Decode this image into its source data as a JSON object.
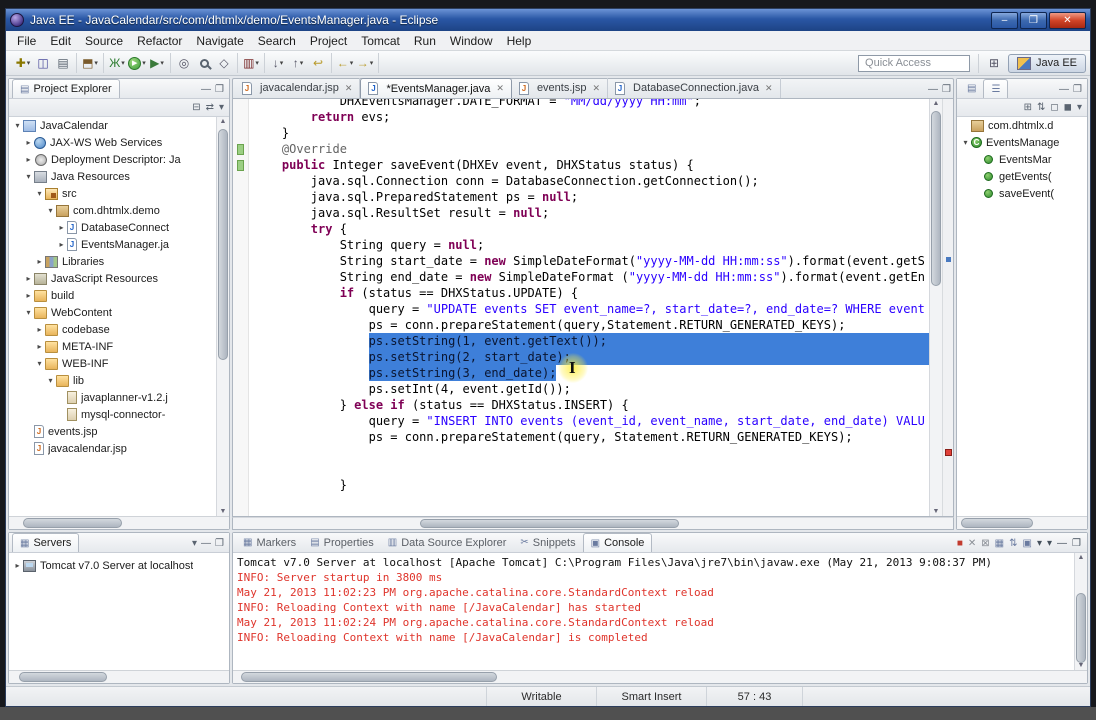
{
  "colors": {
    "selection": "#3e7fd9",
    "keyword": "#7f0055",
    "string": "#2a00ff",
    "annotation": "#646464",
    "stderr": "#df342b",
    "titlebar": "#2a57a5"
  },
  "window": {
    "title": "Java EE - JavaCalendar/src/com/dhtmlx/demo/EventsManager.java - Eclipse",
    "controls": [
      {
        "n": "minimize-button",
        "g": "–"
      },
      {
        "n": "maximize-button",
        "g": "❐"
      },
      {
        "n": "close-button",
        "g": "✕",
        "cls": "close"
      }
    ]
  },
  "menu": {
    "items": [
      "File",
      "Edit",
      "Source",
      "Refactor",
      "Navigate",
      "Search",
      "Project",
      "Tomcat",
      "Run",
      "Window",
      "Help"
    ]
  },
  "toolbar": {
    "quick_access": "Quick Access",
    "perspective": {
      "label": "Java EE"
    },
    "open_perspective_glyph": "⊞",
    "groups": [
      [
        {
          "n": "new-wizard-button",
          "g": "✚",
          "c": "#8a7800",
          "dd": true
        },
        {
          "n": "save-button",
          "g": "◫",
          "c": "#4a4a9c"
        },
        {
          "n": "print-button",
          "g": "▤",
          "c": "#5a6470"
        }
      ],
      [
        {
          "n": "new-java-ee-project-button",
          "g": "⬒",
          "c": "#7a5a2a",
          "dd": true
        }
      ],
      [
        {
          "n": "debug-button",
          "g": "Ж",
          "c": "#2f7d32",
          "dd": true
        },
        {
          "n": "run-button",
          "cls": "run-ic",
          "g": "▶",
          "dd": true
        },
        {
          "n": "external-tools-button",
          "g": "▶",
          "c": "#3a7a3a",
          "dd": true
        }
      ],
      [
        {
          "n": "new-servlet-button",
          "g": "◎",
          "c": "#556",
          "dd": false
        },
        {
          "n": "search-button",
          "cls": "mag",
          "g": ""
        },
        {
          "n": "open-type-button",
          "g": "◇",
          "c": "#556"
        }
      ],
      [
        {
          "n": "coverage-button",
          "g": "▥",
          "c": "#7a2a2a",
          "dd": true
        }
      ],
      [
        {
          "n": "next-annotation-button",
          "g": "↓",
          "c": "#556",
          "dd": true
        },
        {
          "n": "previous-annotation-button",
          "g": "↑",
          "c": "#556",
          "dd": true
        },
        {
          "n": "last-edit-location-button",
          "g": "↩",
          "c": "#b89a2a"
        }
      ],
      [
        {
          "n": "back-button",
          "g": "←",
          "c": "#b89a2a",
          "dd": true
        },
        {
          "n": "forward-button",
          "g": "→",
          "c": "#b89a2a",
          "dd": true
        }
      ]
    ]
  },
  "minmax": [
    {
      "n": "minimize-button",
      "g": "—"
    },
    {
      "n": "maximize-button",
      "g": "❐"
    }
  ],
  "icon_defs": {
    "jfile": {
      "letter": "J",
      "color": "#1f62c9"
    },
    "jsp": {
      "letter": "J",
      "color": "#cf6a1f"
    },
    "class": {
      "letter": "C",
      "color": "#ffffff"
    }
  },
  "project_explorer": {
    "tab": "Project Explorer",
    "tools": [
      {
        "n": "collapse-all-icon",
        "g": "⊟"
      },
      {
        "n": "link-with-editor-icon",
        "g": "⇄"
      },
      {
        "n": "view-menu-icon",
        "g": "▾"
      }
    ],
    "items": [
      {
        "d": 0,
        "arrow": "down",
        "icon": "project",
        "label": "JavaCalendar"
      },
      {
        "d": 1,
        "arrow": "right",
        "icon": "jaxws",
        "label": "JAX-WS Web Services"
      },
      {
        "d": 1,
        "arrow": "right",
        "icon": "dd",
        "label": "Deployment Descriptor: Ja"
      },
      {
        "d": 1,
        "arrow": "down",
        "icon": "jres",
        "label": "Java Resources"
      },
      {
        "d": 2,
        "arrow": "down",
        "icon": "srcpkg",
        "label": "src"
      },
      {
        "d": 3,
        "arrow": "down",
        "icon": "package",
        "label": "com.dhtmlx.demo"
      },
      {
        "d": 4,
        "arrow": "right",
        "icon": "jfile",
        "label": "DatabaseConnect"
      },
      {
        "d": 4,
        "arrow": "right",
        "icon": "jfile",
        "label": "EventsManager.ja"
      },
      {
        "d": 2,
        "arrow": "right",
        "icon": "libs",
        "label": "Libraries"
      },
      {
        "d": 1,
        "arrow": "right",
        "icon": "jsres",
        "label": "JavaScript Resources"
      },
      {
        "d": 1,
        "arrow": "right",
        "icon": "folder",
        "label": "build"
      },
      {
        "d": 1,
        "arrow": "down",
        "icon": "folder",
        "label": "WebContent"
      },
      {
        "d": 2,
        "arrow": "right",
        "icon": "folder",
        "label": "codebase"
      },
      {
        "d": 2,
        "arrow": "right",
        "icon": "folder",
        "label": "META-INF"
      },
      {
        "d": 2,
        "arrow": "down",
        "icon": "folder",
        "label": "WEB-INF"
      },
      {
        "d": 3,
        "arrow": "down",
        "icon": "folder",
        "label": "lib"
      },
      {
        "d": 4,
        "arrow": "none",
        "icon": "jar",
        "label": "javaplanner-v1.2.j"
      },
      {
        "d": 4,
        "arrow": "none",
        "icon": "jar",
        "label": "mysql-connector-"
      },
      {
        "d": 1,
        "arrow": "none",
        "icon": "jsp",
        "label": "events.jsp"
      },
      {
        "d": 1,
        "arrow": "none",
        "icon": "jsp",
        "label": "javacalendar.jsp"
      }
    ]
  },
  "editor": {
    "tabs": [
      {
        "label": "javacalendar.jsp",
        "icon": "jsp",
        "active": false
      },
      {
        "label": "*EventsManager.java",
        "icon": "jfile",
        "active": true
      },
      {
        "label": "events.jsp",
        "icon": "jsp",
        "active": false
      },
      {
        "label": "DatabaseConnection.java",
        "icon": "jfile",
        "active": false
      }
    ],
    "cursor": {
      "glyph": "I"
    },
    "code": {
      "marks": [
        3,
        4
      ],
      "lines": [
        {
          "segs": [
            [
              "p",
              "            DHXEventsManager.DATE_FORMAT = "
            ],
            [
              "s",
              "\"MM/dd/yyyy HH:mm\""
            ],
            [
              "p",
              ";"
            ]
          ]
        },
        {
          "segs": [
            [
              "p",
              "        "
            ],
            [
              "k",
              "return"
            ],
            [
              "p",
              " evs;"
            ]
          ]
        },
        {
          "segs": [
            [
              "p",
              "    }"
            ]
          ]
        },
        {
          "segs": [
            [
              "a",
              "    @Override"
            ]
          ]
        },
        {
          "segs": [
            [
              "p",
              "    "
            ],
            [
              "k",
              "public"
            ],
            [
              "p",
              " Integer saveEvent(DHXEv event, DHXStatus status) {"
            ]
          ]
        },
        {
          "segs": [
            [
              "p",
              "        java.sql.Connection conn = DatabaseConnection.getConnection();"
            ]
          ]
        },
        {
          "segs": [
            [
              "p",
              "        java.sql.PreparedStatement ps = "
            ],
            [
              "k",
              "null"
            ],
            [
              "p",
              ";"
            ]
          ]
        },
        {
          "segs": [
            [
              "p",
              "        java.sql.ResultSet result = "
            ],
            [
              "k",
              "null"
            ],
            [
              "p",
              ";"
            ]
          ]
        },
        {
          "segs": [
            [
              "p",
              "        "
            ],
            [
              "k",
              "try"
            ],
            [
              "p",
              " {"
            ]
          ]
        },
        {
          "segs": [
            [
              "p",
              "            String query = "
            ],
            [
              "k",
              "null"
            ],
            [
              "p",
              ";"
            ]
          ]
        },
        {
          "segs": [
            [
              "p",
              "            String start_date = "
            ],
            [
              "k",
              "new"
            ],
            [
              "p",
              " SimpleDateFormat("
            ],
            [
              "s",
              "\"yyyy-MM-dd HH:mm:ss\""
            ],
            [
              "p",
              ").format(event.getS"
            ]
          ]
        },
        {
          "segs": [
            [
              "p",
              "            String end_date = "
            ],
            [
              "k",
              "new"
            ],
            [
              "p",
              " SimpleDateFormat ("
            ],
            [
              "s",
              "\"yyyy-MM-dd HH:mm:ss\""
            ],
            [
              "p",
              ").format(event.getEn"
            ]
          ]
        },
        {
          "segs": [
            [
              "p",
              "            "
            ],
            [
              "k",
              "if"
            ],
            [
              "p",
              " (status == DHXStatus.UPDATE) {"
            ]
          ]
        },
        {
          "segs": [
            [
              "p",
              "                query = "
            ],
            [
              "s",
              "\"UPDATE events SET event_name=?, start_date=?, end_date=? WHERE event"
            ]
          ]
        },
        {
          "segs": [
            [
              "p",
              "                ps = conn.prepareStatement(query,Statement.RETURN_GENERATED_KEYS);"
            ]
          ]
        },
        {
          "segs": [
            [
              "p",
              "                "
            ],
            [
              "ps",
              "ps.setString(1, event.getText());"
            ],
            [
              "fill",
              ""
            ]
          ]
        },
        {
          "segs": [
            [
              "p",
              "                "
            ],
            [
              "ps",
              "ps.setString(2, start_date);"
            ],
            [
              "fill",
              ""
            ]
          ]
        },
        {
          "segs": [
            [
              "p",
              "                "
            ],
            [
              "ps",
              "ps.setString(3, end_date);"
            ]
          ]
        },
        {
          "segs": [
            [
              "p",
              "                ps.setInt(4, event.getId());"
            ]
          ]
        },
        {
          "segs": [
            [
              "p",
              "            } "
            ],
            [
              "k",
              "else"
            ],
            [
              "p",
              " "
            ],
            [
              "k",
              "if"
            ],
            [
              "p",
              " (status == DHXStatus.INSERT) {"
            ]
          ]
        },
        {
          "segs": [
            [
              "p",
              "                query = "
            ],
            [
              "s",
              "\"INSERT INTO events (event_id, event_name, start_date, end_date) VALU"
            ]
          ]
        },
        {
          "segs": [
            [
              "p",
              "                ps = conn.prepareStatement(query, Statement.RETURN_GENERATED_KEYS);"
            ]
          ]
        },
        {
          "segs": [
            [
              "p",
              ""
            ]
          ]
        },
        {
          "segs": [
            [
              "p",
              ""
            ]
          ]
        },
        {
          "segs": [
            [
              "p",
              "            }"
            ]
          ]
        },
        {
          "segs": [
            [
              "p",
              ""
            ]
          ]
        }
      ]
    }
  },
  "outline": {
    "tabs": [
      {
        "n": "task-list-tab",
        "g": "▤"
      },
      {
        "n": "outline-tab",
        "g": "☰"
      }
    ],
    "tools": [
      {
        "n": "expand-all-icon",
        "g": "⊞"
      },
      {
        "n": "sort-icon",
        "g": "⇅"
      },
      {
        "n": "hide-fields-icon",
        "g": "◻"
      },
      {
        "n": "hide-static-icon",
        "g": "◼"
      },
      {
        "n": "view-menu-icon",
        "g": "▾"
      }
    ],
    "items": [
      {
        "d": 0,
        "arrow": "none",
        "icon": "package",
        "label": "com.dhtmlx.d"
      },
      {
        "d": 0,
        "arrow": "down",
        "icon": "class",
        "label": "EventsManage"
      },
      {
        "d": 1,
        "arrow": "none",
        "icon": "ctor",
        "label": "EventsMar"
      },
      {
        "d": 1,
        "arrow": "none",
        "icon": "method",
        "label": "getEvents("
      },
      {
        "d": 1,
        "arrow": "none",
        "icon": "method",
        "label": "saveEvent("
      }
    ]
  },
  "servers": {
    "tab": "Servers",
    "tools": [
      {
        "n": "view-menu-icon",
        "g": "▾"
      }
    ],
    "items": [
      {
        "d": 0,
        "arrow": "right",
        "icon": "server",
        "label": "Tomcat v7.0 Server at localhost"
      }
    ]
  },
  "console_area": {
    "tabs": [
      {
        "label": "Markers",
        "icon": "▦",
        "icon_name": "markers-icon",
        "active": false
      },
      {
        "label": "Properties",
        "icon": "▤",
        "icon_name": "properties-icon",
        "active": false
      },
      {
        "label": "Data Source Explorer",
        "icon": "▥",
        "icon_name": "data-source-explorer-icon",
        "active": false
      },
      {
        "label": "Snippets",
        "icon": "✂",
        "icon_name": "snippets-icon",
        "active": false
      },
      {
        "label": "Console",
        "icon": "▣",
        "icon_name": "console-icon",
        "active": true
      }
    ],
    "tools": [
      {
        "n": "terminate-icon",
        "g": "■",
        "c": "#c23b2e"
      },
      {
        "n": "remove-launch-icon",
        "g": "✕",
        "c": "#8a8f96"
      },
      {
        "n": "remove-all-launches-icon",
        "g": "⊠",
        "c": "#8a8f96"
      },
      {
        "n": "clear-console-icon",
        "g": "▦",
        "c": "#6a7ba0"
      },
      {
        "n": "scroll-lock-icon",
        "g": "⇅",
        "c": "#6a7ba0"
      },
      {
        "n": "pin-console-icon",
        "g": "▣",
        "c": "#6a7ba0"
      },
      {
        "n": "display-console-icon",
        "g": "▾",
        "c": "#44505c"
      },
      {
        "n": "open-console-icon",
        "g": "▾",
        "c": "#44505c"
      },
      {
        "n": "minimize-icon",
        "g": "—",
        "c": "#44505c"
      },
      {
        "n": "maximize-icon",
        "g": "❐",
        "c": "#44505c"
      }
    ],
    "lines": [
      {
        "t": "Tomcat v7.0 Server at localhost [Apache Tomcat] C:\\Program Files\\Java\\jre7\\bin\\javaw.exe (May 21, 2013 9:08:37 PM)",
        "c": "black"
      },
      {
        "t": "INFO: Server startup in 3800 ms",
        "c": "red"
      },
      {
        "t": "May 21, 2013 11:02:23 PM org.apache.catalina.core.StandardContext reload",
        "c": "red"
      },
      {
        "t": "INFO: Reloading Context with name [/JavaCalendar] has started",
        "c": "red"
      },
      {
        "t": "May 21, 2013 11:02:24 PM org.apache.catalina.core.StandardContext reload",
        "c": "red"
      },
      {
        "t": "INFO: Reloading Context with name [/JavaCalendar] is completed",
        "c": "red"
      }
    ]
  },
  "status": {
    "writable": "Writable",
    "insert_mode": "Smart Insert",
    "caret": "57 : 43"
  }
}
